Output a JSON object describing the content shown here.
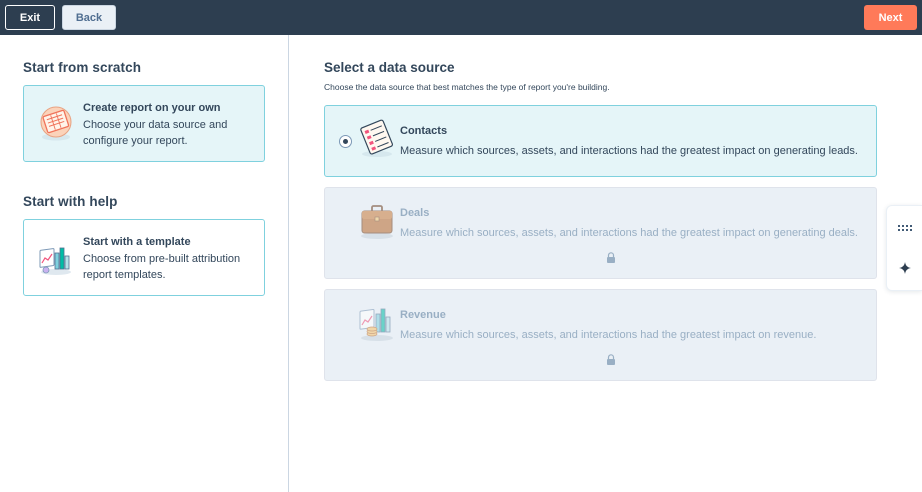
{
  "topbar": {
    "exit_label": "Exit",
    "back_label": "Back",
    "next_label": "Next"
  },
  "left": {
    "scratch_heading": "Start from scratch",
    "scratch_option": {
      "title": "Create report on your own",
      "description": "Choose your data source and configure your report.",
      "icon": "report-sheet-icon"
    },
    "help_heading": "Start with help",
    "help_option": {
      "title": "Start with a template",
      "description": "Choose from pre-built attribution report templates.",
      "icon": "bar-chart-icon"
    }
  },
  "right": {
    "heading": "Select a data source",
    "subheading": "Choose the data source that best matches the type of report you're building.",
    "sources": [
      {
        "title": "Contacts",
        "description": "Measure which sources, assets, and interactions had the greatest impact on generating leads.",
        "state": "selected",
        "icon": "contacts-list-icon"
      },
      {
        "title": "Deals",
        "description": "Measure which sources, assets, and interactions had the greatest impact on generating deals.",
        "state": "locked",
        "icon": "briefcase-icon"
      },
      {
        "title": "Revenue",
        "description": "Measure which sources, assets, and interactions had the greatest impact on revenue.",
        "state": "locked",
        "icon": "revenue-chart-icon"
      }
    ]
  },
  "colors": {
    "topbar": "#2d3e50",
    "accent": "#ff7a59",
    "selected_bg": "#e5f5f8",
    "selected_border": "#7fd1de",
    "disabled_bg": "#eaf0f6",
    "text": "#33475b",
    "muted_text": "#99afc4"
  }
}
